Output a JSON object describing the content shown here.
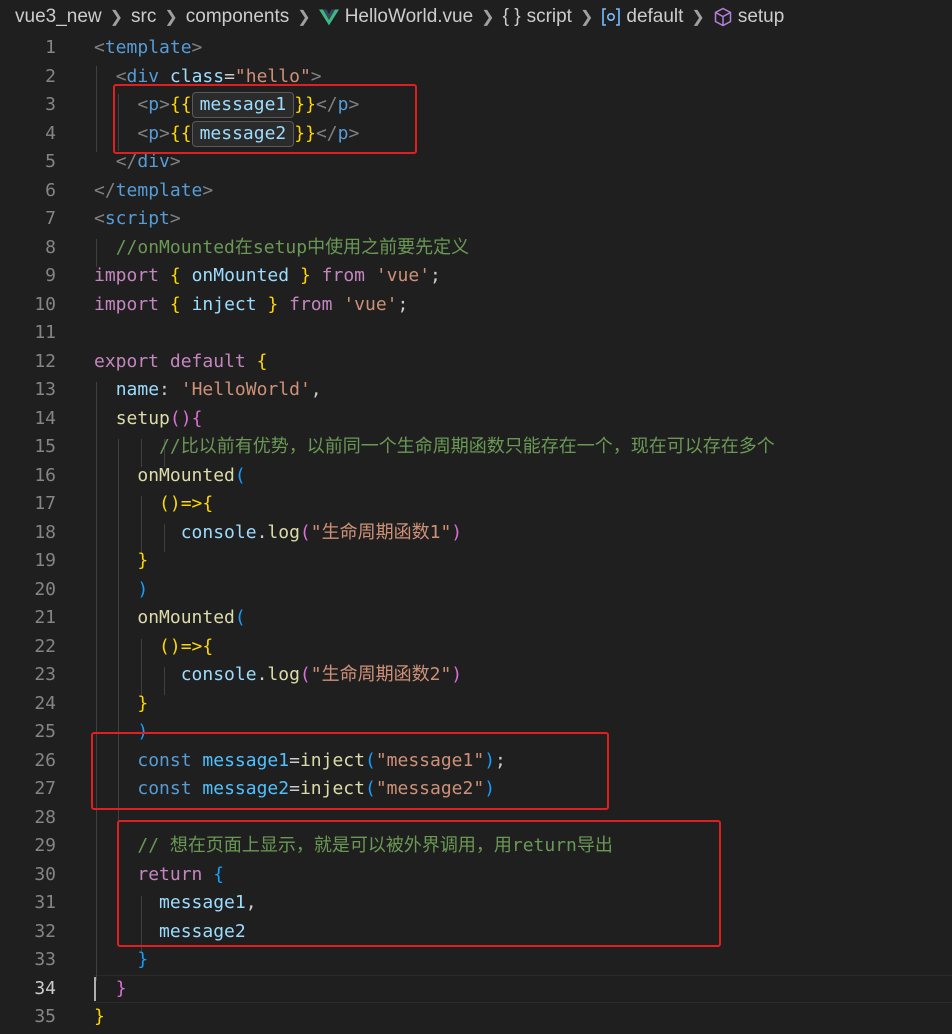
{
  "breadcrumb": {
    "items": [
      "vue3_new",
      "src",
      "components",
      "HelloWorld.vue",
      "script",
      "default",
      "setup"
    ],
    "braces_glyph": "{ }"
  },
  "editor": {
    "active_line": 34,
    "line_numbers": [
      "1",
      "2",
      "3",
      "4",
      "5",
      "6",
      "7",
      "8",
      "9",
      "10",
      "11",
      "12",
      "13",
      "14",
      "15",
      "16",
      "17",
      "18",
      "19",
      "20",
      "21",
      "22",
      "23",
      "24",
      "25",
      "26",
      "27",
      "28",
      "29",
      "30",
      "31",
      "32",
      "33",
      "34",
      "35"
    ],
    "code": {
      "l1_tag": "template",
      "l2_tag": "div",
      "l2_attr": "class",
      "l2_val": "\"hello\"",
      "l3_tag": "p",
      "l3_open": "{{",
      "l3_expr": "message1",
      "l3_close": "}}",
      "l4_tag": "p",
      "l4_open": "{{",
      "l4_expr": "message2",
      "l4_close": "}}",
      "l5_tag": "div",
      "l6_tag": "template",
      "l7_tag": "script",
      "l8_comment": "//onMounted在setup中使用之前要先定义",
      "l9_import": "import",
      "l9_name": "onMounted",
      "l9_from": "from",
      "l9_mod": "'vue'",
      "l10_import": "import",
      "l10_name": "inject",
      "l10_from": "from",
      "l10_mod": "'vue'",
      "l12_export": "export",
      "l12_default": "default",
      "l13_key": "name",
      "l13_val": "'HelloWorld'",
      "l14_fn": "setup",
      "l15_comment": "//比以前有优势，以前同一个生命周期函数只能存在一个，现在可以存在多个",
      "l16_fn": "onMounted",
      "l17_arrow": "()=>",
      "l18_obj": "console",
      "l18_fn": "log",
      "l18_str": "\"生命周期函数1\"",
      "l21_fn": "onMounted",
      "l22_arrow": "()=>",
      "l23_obj": "console",
      "l23_fn": "log",
      "l23_str": "\"生命周期函数2\"",
      "l26_const": "const",
      "l26_name": "message1",
      "l26_fn": "inject",
      "l26_str": "\"message1\"",
      "l27_const": "const",
      "l27_name": "message2",
      "l27_fn": "inject",
      "l27_str": "\"message2\"",
      "l29_comment": "// 想在页面上显示，就是可以被外界调用，用return导出",
      "l30_return": "return",
      "l31_name": "message1",
      "l32_name": "message2"
    }
  },
  "colors": {
    "background": "#1f1f1f",
    "highlight_box": "#e02020",
    "keyword": "#c586c0",
    "string": "#ce9178",
    "comment": "#6a9955",
    "function": "#dcdcaa",
    "variable": "#9cdcfe"
  },
  "icons": [
    "vue-logo-icon",
    "braces-icon",
    "module-icon",
    "method-cube-icon",
    "chevron-right-icon"
  ]
}
